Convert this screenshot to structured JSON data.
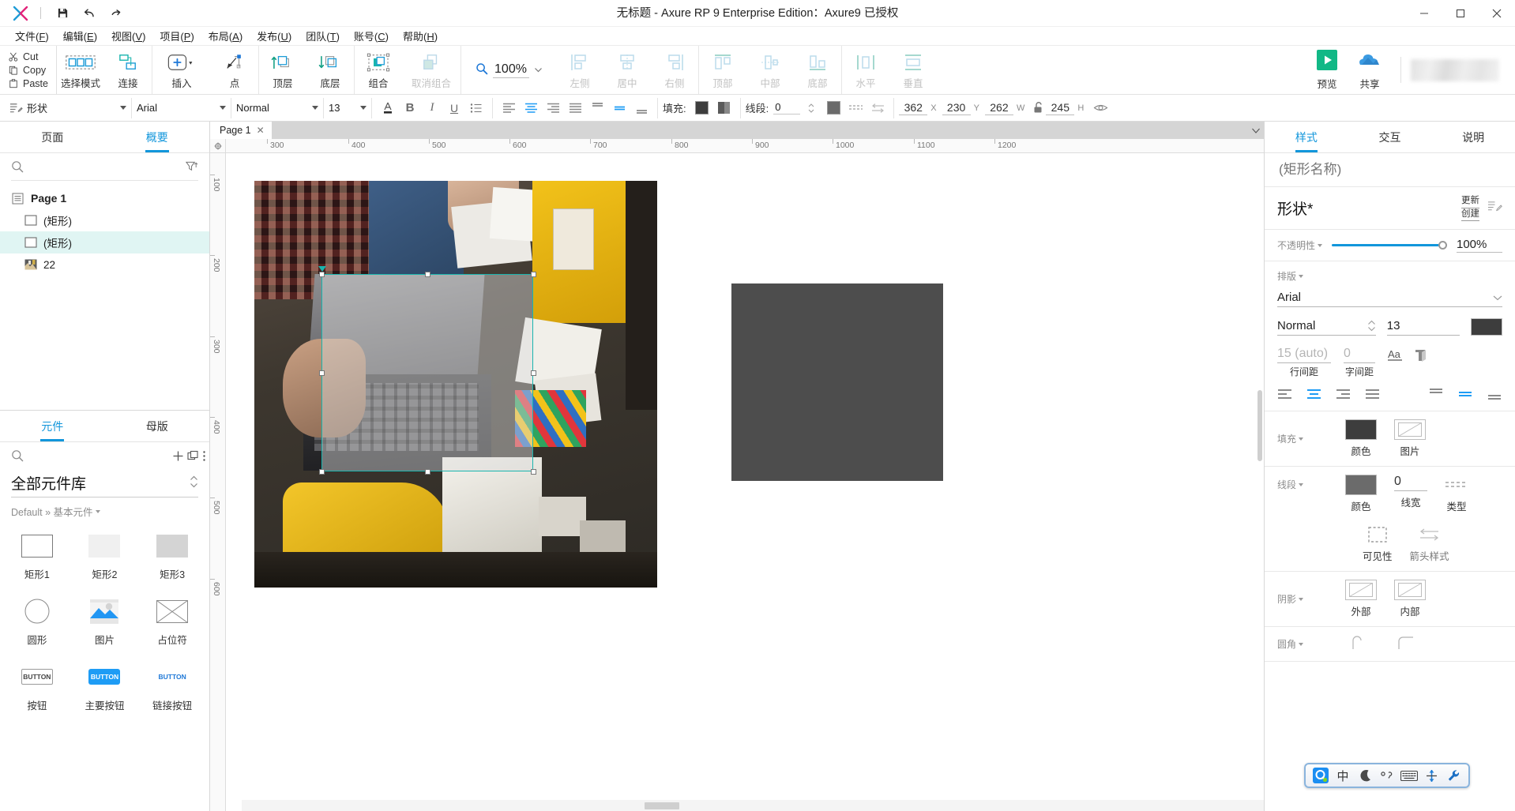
{
  "window": {
    "title": "无标题 - Axure RP 9 Enterprise Edition：Axure9 已授权",
    "controls": {
      "minimize": "–",
      "maximize": "□",
      "close": "✕"
    }
  },
  "quickbar": [
    {
      "name": "save-icon",
      "label": "保存"
    },
    {
      "name": "undo-icon",
      "label": "撤销"
    },
    {
      "name": "redo-icon",
      "label": "重做"
    }
  ],
  "menubar": [
    {
      "label": "文件",
      "key": "F"
    },
    {
      "label": "编辑",
      "key": "E"
    },
    {
      "label": "视图",
      "key": "V"
    },
    {
      "label": "项目",
      "key": "P"
    },
    {
      "label": "布局",
      "key": "A"
    },
    {
      "label": "发布",
      "key": "U"
    },
    {
      "label": "团队",
      "key": "T"
    },
    {
      "label": "账号",
      "key": "C"
    },
    {
      "label": "帮助",
      "key": "H"
    }
  ],
  "clipboard": {
    "cut": "Cut",
    "copy": "Copy",
    "paste": "Paste"
  },
  "toolbar": {
    "groups": [
      {
        "items": [
          {
            "label": "选择模式",
            "icon": "select-mode-icon",
            "state": "normal"
          },
          {
            "label": "连接",
            "icon": "connect-icon",
            "state": "normal"
          }
        ]
      },
      {
        "items": [
          {
            "label": "插入",
            "icon": "insert-icon",
            "state": "normal",
            "dropdown": true
          },
          {
            "label": "点",
            "icon": "point-icon",
            "state": "normal"
          }
        ]
      },
      {
        "items": [
          {
            "label": "顶层",
            "icon": "bring-front-icon",
            "state": "normal"
          },
          {
            "label": "底层",
            "icon": "send-back-icon",
            "state": "normal"
          }
        ]
      },
      {
        "items": [
          {
            "label": "组合",
            "icon": "group-icon",
            "state": "normal"
          },
          {
            "label": "取消组合",
            "icon": "ungroup-icon",
            "state": "disabled"
          }
        ]
      }
    ],
    "zoom": {
      "value": "100%",
      "icon": "zoom-icon"
    },
    "align_h": [
      {
        "label": "左侧",
        "icon": "align-left-icon",
        "state": "disabled"
      },
      {
        "label": "居中",
        "icon": "align-center-icon",
        "state": "disabled"
      },
      {
        "label": "右侧",
        "icon": "align-right-icon",
        "state": "disabled"
      }
    ],
    "align_v": [
      {
        "label": "顶部",
        "icon": "align-top-icon",
        "state": "disabled"
      },
      {
        "label": "中部",
        "icon": "align-middle-icon",
        "state": "disabled"
      },
      {
        "label": "底部",
        "icon": "align-bottom-icon",
        "state": "disabled"
      }
    ],
    "distribute": [
      {
        "label": "水平",
        "icon": "distribute-h-icon",
        "state": "disabled"
      },
      {
        "label": "垂直",
        "icon": "distribute-v-icon",
        "state": "disabled"
      }
    ],
    "preview": {
      "label": "预览",
      "icon": "preview-play-icon",
      "color": "#12b886"
    },
    "share": {
      "label": "共享",
      "icon": "share-cloud-icon",
      "color": "#3b9ae1"
    }
  },
  "formatbar": {
    "shape_type": "形状",
    "font_family": "Arial",
    "font_weight": "Normal",
    "font_size": "13",
    "text_color_icon": "text-color-icon",
    "bold": "B",
    "italic": "I",
    "underline": "U",
    "bullets_icon": "bullet-list-icon",
    "align_icons": [
      "align-left-icon",
      "align-center-icon",
      "align-right-icon",
      "align-justify-icon"
    ],
    "valign_icons": [
      "valign-top-icon",
      "valign-middle-icon",
      "valign-bottom-icon"
    ],
    "fill_label": "填充:",
    "fill_color": "#3d3d3d",
    "fill_gradient_icon": "fill-gradient-icon",
    "line_label": "线段:",
    "line_width": "0",
    "line_color": "#6b6b6b",
    "line_type_icon": "line-type-icon",
    "arrow_icon": "arrow-style-icon",
    "x": "362",
    "x_label": "X",
    "y": "230",
    "y_label": "Y",
    "w": "262",
    "w_label": "W",
    "lock_icon": "lock-open-icon",
    "h": "245",
    "h_label": "H",
    "visibility_icon": "eye-icon"
  },
  "left_panel": {
    "tabs": [
      {
        "label": "页面",
        "active": false
      },
      {
        "label": "概要",
        "active": true
      }
    ],
    "search_placeholder": "",
    "filter_icon": "filter-sort-icon",
    "outline": [
      {
        "label": "Page 1",
        "icon": "page-icon",
        "level": 0,
        "selected": false
      },
      {
        "label": "(矩形)",
        "icon": "rectangle-icon",
        "level": 1,
        "selected": false
      },
      {
        "label": "(矩形)",
        "icon": "rectangle-icon",
        "level": 1,
        "selected": true
      },
      {
        "label": "22",
        "icon": "image-thumb-icon",
        "level": 1,
        "selected": false
      }
    ],
    "library": {
      "tabs": [
        {
          "label": "元件",
          "active": true
        },
        {
          "label": "母版",
          "active": false
        }
      ],
      "search_placeholder": "",
      "add_icon": "plus-icon",
      "duplicate_icon": "copy-icon",
      "more_icon": "more-vertical-icon",
      "title": "全部元件库",
      "breadcrumb": "Default » 基本元件",
      "widgets": [
        {
          "label": "矩形1",
          "icon": "rect-outline-thumb"
        },
        {
          "label": "矩形2",
          "icon": "rect-light-thumb"
        },
        {
          "label": "矩形3",
          "icon": "rect-grey-thumb"
        },
        {
          "label": "圆形",
          "icon": "circle-thumb"
        },
        {
          "label": "图片",
          "icon": "image-thumb"
        },
        {
          "label": "占位符",
          "icon": "placeholder-thumb"
        },
        {
          "label": "按钮",
          "icon": "button-outline-thumb"
        },
        {
          "label": "主要按钮",
          "icon": "button-primary-thumb"
        },
        {
          "label": "链接按钮",
          "icon": "button-link-thumb"
        }
      ],
      "widget_button_text": "BUTTON"
    }
  },
  "canvas": {
    "page_tab": {
      "label": "Page 1",
      "close": "✕"
    },
    "ruler_h_labels": [
      "300",
      "400",
      "500",
      "600",
      "700",
      "800",
      "900",
      "1000",
      "1100",
      "1200"
    ],
    "ruler_v_labels": [
      "100",
      "200",
      "300",
      "400",
      "500",
      "600"
    ],
    "selection": {
      "x": "362",
      "y": "230",
      "w": "262",
      "h": "245"
    }
  },
  "right_panel": {
    "tabs": [
      {
        "label": "样式",
        "active": true
      },
      {
        "label": "交互",
        "active": false
      },
      {
        "label": "说明",
        "active": false
      }
    ],
    "name_placeholder": "(矩形名称)",
    "style_name": "形状*",
    "update": "更新",
    "create": "创建",
    "edit_style_icon": "edit-style-icon",
    "opacity": {
      "label": "不透明性",
      "value": "100%"
    },
    "typography": {
      "label": "排版",
      "font_family": "Arial",
      "font_weight": "Normal",
      "font_size": "13",
      "font_color": "#3d3d3d",
      "line_height": "15 (auto)",
      "line_height_label": "行间距",
      "letter_spacing": "0",
      "letter_spacing_label": "字间距",
      "case_icon": "text-case-icon",
      "decoration_icon": "text-decoration-icon"
    },
    "fill": {
      "label": "填充",
      "color_label": "颜色",
      "color": "#3d3d3d",
      "image_label": "图片",
      "image_icon": "fill-image-icon"
    },
    "line": {
      "label": "线段",
      "color_label": "颜色",
      "color": "#6b6b6b",
      "width_label": "线宽",
      "width": "0",
      "type_label": "类型",
      "type_icon": "line-dash-icon",
      "visibility_label": "可见性",
      "visibility_icon": "visibility-box-icon",
      "arrow_label": "箭头样式",
      "arrow_icon": "arrow-style-icon"
    },
    "shadow": {
      "label": "阴影",
      "outer_label": "外部",
      "inner_label": "内部",
      "outer_icon": "shadow-outer-icon",
      "inner_icon": "shadow-inner-icon"
    },
    "corner": {
      "label": "圆角"
    }
  },
  "ime_bar": {
    "items": [
      {
        "icon": "qq-pinyin-logo-icon"
      },
      {
        "icon": "chinese-mode-icon",
        "label": "中"
      },
      {
        "icon": "half-moon-icon"
      },
      {
        "icon": "punctuation-icon"
      },
      {
        "icon": "keyboard-icon"
      },
      {
        "icon": "toolbox-icon"
      },
      {
        "icon": "wrench-icon"
      }
    ]
  }
}
